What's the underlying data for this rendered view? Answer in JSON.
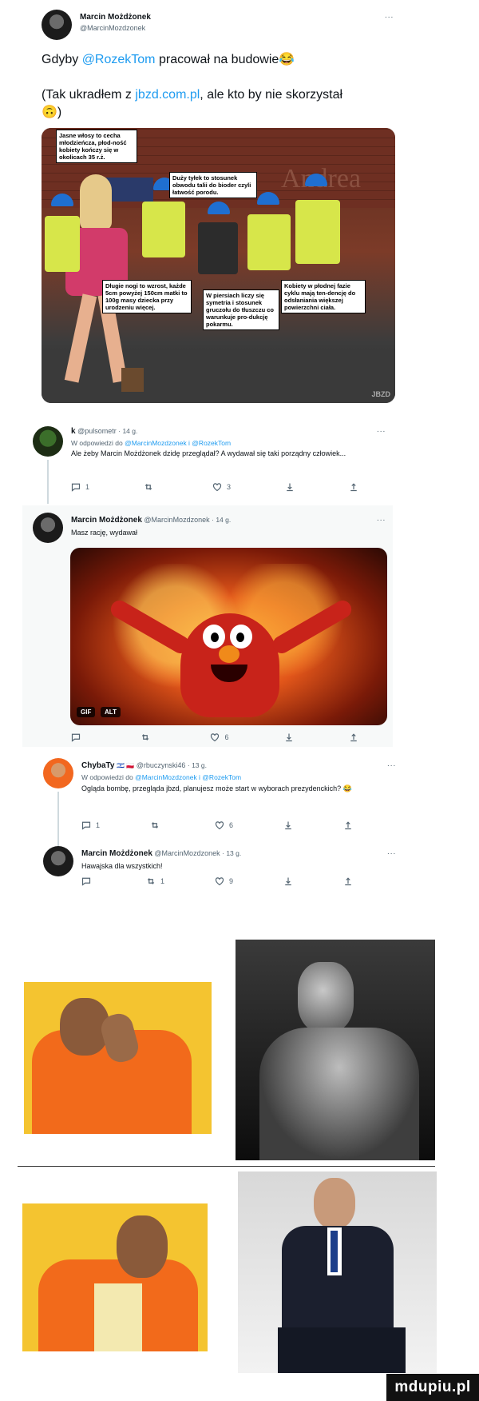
{
  "main_tweet": {
    "author_name": "Marcin Możdżonek",
    "author_handle": "@MarcinMozdzonek",
    "text_part1": "Gdyby ",
    "text_mention": "@RozekTom",
    "text_part2": " pracował na budowie",
    "emoji1": "😂",
    "text2_part1": "(Tak ukradłem z ",
    "text2_link": "jbzd.com.pl",
    "text2_part2": ", ale kto by nie skorzystał",
    "emoji2": "🙃",
    "text2_close": ")",
    "dots": "..."
  },
  "meme_image": {
    "store_sign": "Andrea",
    "caption_hair": "Jasne włosy to cecha młodzieńcza, płod-ność kobiety kończy się w okolicach 35 r.ż.",
    "caption_waist": "Duży tyłek to stosunek obwodu talii do bioder czyli łatwość porodu.",
    "caption_legs": "Długie nogi to wzrost, każde 5cm powyżej 150cm matki to 100g masy dziecka przy urodzeniu więcej.",
    "caption_breasts": "W piersiach liczy się symetria i stosunek gruczołu do tłuszczu co warunkuje pro-dukcję pokarmu.",
    "caption_fertile": "Kobiety w płodnej fazie cyklu mają ten-dencję do odsłaniania większej powierzchni ciała.",
    "watermark_small": "JBZD"
  },
  "replies": [
    {
      "author_name": "k",
      "author_handle": "@pulsometr",
      "time": "14 g.",
      "reply_to_prefix": "W odpowiedzi do ",
      "reply_to": "@MarcinMozdzonek i @RozekTom",
      "text": "Ale żeby Marcin Możdżonek dzidę przeglądał? A wydawał się taki porządny człowiek...",
      "replies_count": "1",
      "retweets_count": "",
      "likes_count": "3",
      "dots": "..."
    },
    {
      "author_name": "Marcin Możdżonek",
      "author_handle": "@MarcinMozdzonek",
      "time": "14 g.",
      "text": "Masz rację, wydawał",
      "gif_badge": "GIF",
      "alt_badge": "ALT",
      "replies_count": "",
      "retweets_count": "",
      "likes_count": "6",
      "dots": "..."
    },
    {
      "author_name": "ChybaTy",
      "author_flags": "🇮🇱 🇵🇱",
      "author_handle": "@rbuczynski46",
      "time": "13 g.",
      "reply_to_prefix": "W odpowiedzi do ",
      "reply_to": "@MarcinMozdzonek i @RozekTom",
      "text": "Ogląda bombę, przegląda jbzd, planujesz może start w wyborach prezydenckich?",
      "emoji": "😂",
      "replies_count": "1",
      "retweets_count": "",
      "likes_count": "6",
      "dots": "..."
    },
    {
      "author_name": "Marcin Możdżonek",
      "author_handle": "@MarcinMozdzonek",
      "time": "13 g.",
      "text": "Hawajska dla wszystkich!",
      "replies_count": "",
      "retweets_count": "1",
      "likes_count": "9",
      "dots": "..."
    }
  ],
  "watermark": "mdupiu.pl",
  "colors": {
    "link": "#1d9bf0",
    "vest": "#d7e64a",
    "helmet": "#1f6fd1",
    "drake_orange": "#f26a1b",
    "drake_yellow": "#f4c430"
  },
  "icons": [
    "reply-icon",
    "retweet-icon",
    "like-icon",
    "share-icon",
    "upload-icon"
  ]
}
